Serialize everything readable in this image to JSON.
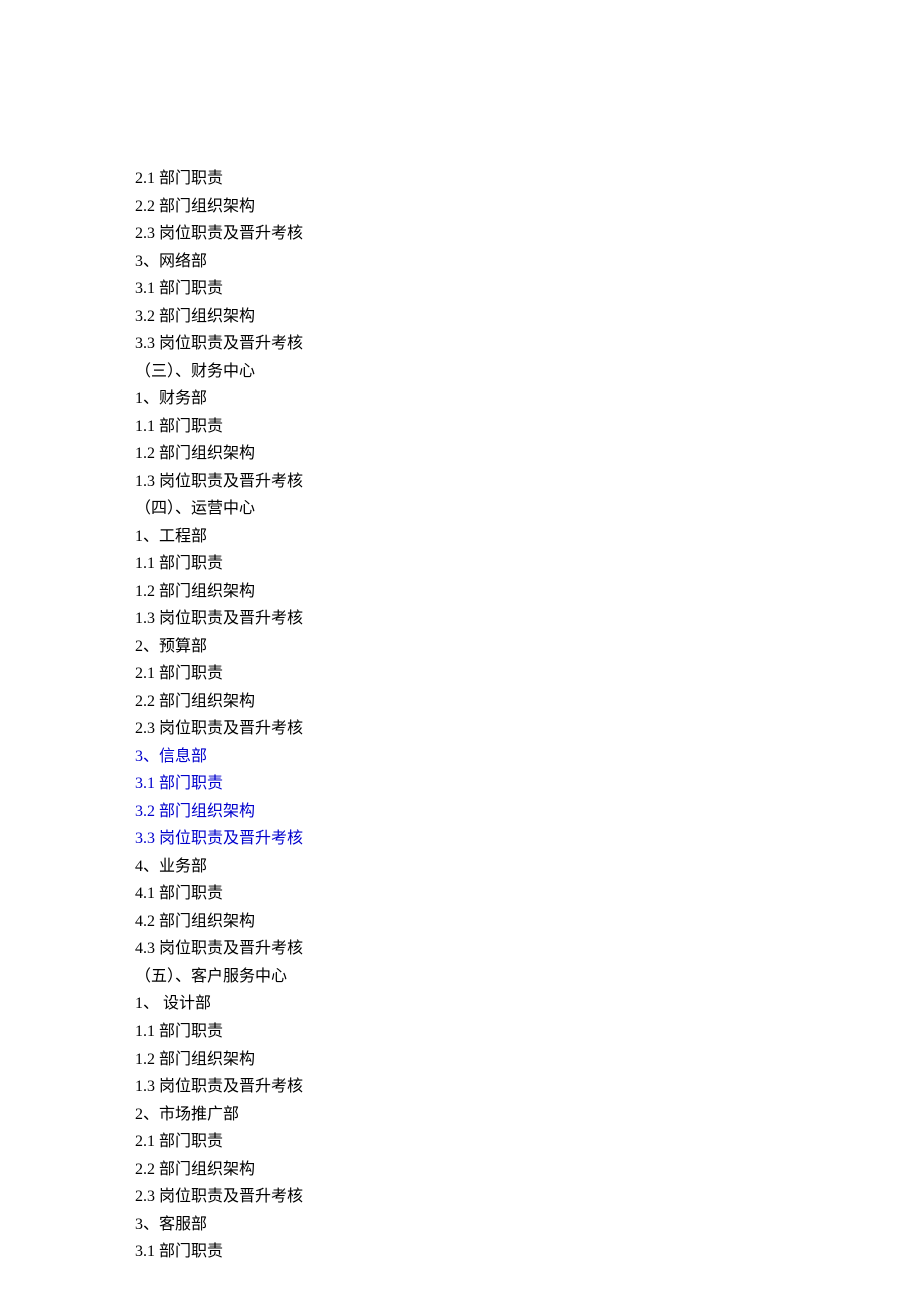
{
  "toc": [
    {
      "text": "2.1 部门职责",
      "link": false
    },
    {
      "text": "2.2 部门组织架构",
      "link": false
    },
    {
      "text": "2.3 岗位职责及晋升考核",
      "link": false
    },
    {
      "text": "3、网络部",
      "link": false
    },
    {
      "text": "3.1 部门职责",
      "link": false
    },
    {
      "text": "3.2 部门组织架构",
      "link": false
    },
    {
      "text": "3.3 岗位职责及晋升考核",
      "link": false
    },
    {
      "text": "（三）、财务中心",
      "link": false
    },
    {
      "text": "1、财务部",
      "link": false
    },
    {
      "text": "1.1 部门职责",
      "link": false
    },
    {
      "text": "1.2 部门组织架构",
      "link": false
    },
    {
      "text": "1.3 岗位职责及晋升考核",
      "link": false
    },
    {
      "text": "（四）、运营中心",
      "link": false
    },
    {
      "text": "1、工程部",
      "link": false
    },
    {
      "text": "1.1 部门职责",
      "link": false
    },
    {
      "text": "1.2 部门组织架构",
      "link": false
    },
    {
      "text": "1.3 岗位职责及晋升考核",
      "link": false
    },
    {
      "text": "2、预算部",
      "link": false
    },
    {
      "text": "2.1 部门职责",
      "link": false
    },
    {
      "text": "2.2 部门组织架构",
      "link": false
    },
    {
      "text": "2.3 岗位职责及晋升考核",
      "link": false
    },
    {
      "text": "3、信息部",
      "link": true
    },
    {
      "text": "3.1 部门职责",
      "link": true
    },
    {
      "text": "3.2 部门组织架构",
      "link": true
    },
    {
      "text": "3.3 岗位职责及晋升考核",
      "link": true
    },
    {
      "text": "4、业务部",
      "link": false
    },
    {
      "text": "4.1 部门职责",
      "link": false
    },
    {
      "text": "4.2 部门组织架构",
      "link": false
    },
    {
      "text": "4.3 岗位职责及晋升考核",
      "link": false
    },
    {
      "text": "（五）、客户服务中心",
      "link": false
    },
    {
      "text": "1、 设计部",
      "link": false
    },
    {
      "text": "1.1 部门职责",
      "link": false
    },
    {
      "text": "1.2 部门组织架构",
      "link": false
    },
    {
      "text": "1.3 岗位职责及晋升考核",
      "link": false
    },
    {
      "text": "2、市场推广部",
      "link": false
    },
    {
      "text": "2.1 部门职责",
      "link": false
    },
    {
      "text": "2.2 部门组织架构",
      "link": false
    },
    {
      "text": "2.3 岗位职责及晋升考核",
      "link": false
    },
    {
      "text": "3、客服部",
      "link": false
    },
    {
      "text": "3.1 部门职责",
      "link": false
    }
  ]
}
